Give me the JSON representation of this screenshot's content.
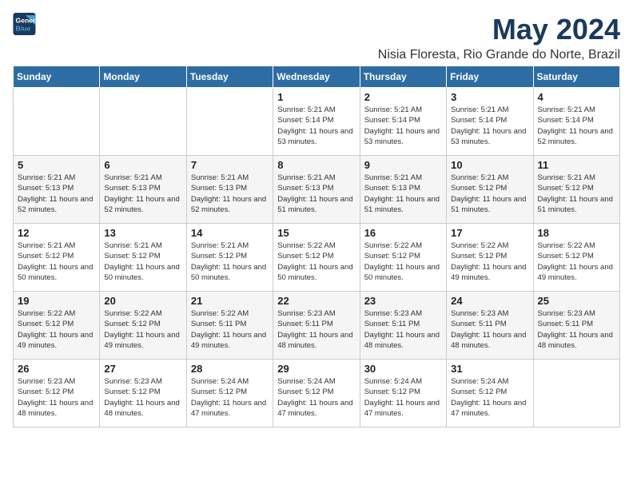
{
  "logo": {
    "line1": "General",
    "line2": "Blue"
  },
  "title": "May 2024",
  "location": "Nisia Floresta, Rio Grande do Norte, Brazil",
  "weekdays": [
    "Sunday",
    "Monday",
    "Tuesday",
    "Wednesday",
    "Thursday",
    "Friday",
    "Saturday"
  ],
  "weeks": [
    [
      {
        "day": "",
        "info": ""
      },
      {
        "day": "",
        "info": ""
      },
      {
        "day": "",
        "info": ""
      },
      {
        "day": "1",
        "info": "Sunrise: 5:21 AM\nSunset: 5:14 PM\nDaylight: 11 hours and 53 minutes."
      },
      {
        "day": "2",
        "info": "Sunrise: 5:21 AM\nSunset: 5:14 PM\nDaylight: 11 hours and 53 minutes."
      },
      {
        "day": "3",
        "info": "Sunrise: 5:21 AM\nSunset: 5:14 PM\nDaylight: 11 hours and 53 minutes."
      },
      {
        "day": "4",
        "info": "Sunrise: 5:21 AM\nSunset: 5:14 PM\nDaylight: 11 hours and 52 minutes."
      }
    ],
    [
      {
        "day": "5",
        "info": "Sunrise: 5:21 AM\nSunset: 5:13 PM\nDaylight: 11 hours and 52 minutes."
      },
      {
        "day": "6",
        "info": "Sunrise: 5:21 AM\nSunset: 5:13 PM\nDaylight: 11 hours and 52 minutes."
      },
      {
        "day": "7",
        "info": "Sunrise: 5:21 AM\nSunset: 5:13 PM\nDaylight: 11 hours and 52 minutes."
      },
      {
        "day": "8",
        "info": "Sunrise: 5:21 AM\nSunset: 5:13 PM\nDaylight: 11 hours and 51 minutes."
      },
      {
        "day": "9",
        "info": "Sunrise: 5:21 AM\nSunset: 5:13 PM\nDaylight: 11 hours and 51 minutes."
      },
      {
        "day": "10",
        "info": "Sunrise: 5:21 AM\nSunset: 5:12 PM\nDaylight: 11 hours and 51 minutes."
      },
      {
        "day": "11",
        "info": "Sunrise: 5:21 AM\nSunset: 5:12 PM\nDaylight: 11 hours and 51 minutes."
      }
    ],
    [
      {
        "day": "12",
        "info": "Sunrise: 5:21 AM\nSunset: 5:12 PM\nDaylight: 11 hours and 50 minutes."
      },
      {
        "day": "13",
        "info": "Sunrise: 5:21 AM\nSunset: 5:12 PM\nDaylight: 11 hours and 50 minutes."
      },
      {
        "day": "14",
        "info": "Sunrise: 5:21 AM\nSunset: 5:12 PM\nDaylight: 11 hours and 50 minutes."
      },
      {
        "day": "15",
        "info": "Sunrise: 5:22 AM\nSunset: 5:12 PM\nDaylight: 11 hours and 50 minutes."
      },
      {
        "day": "16",
        "info": "Sunrise: 5:22 AM\nSunset: 5:12 PM\nDaylight: 11 hours and 50 minutes."
      },
      {
        "day": "17",
        "info": "Sunrise: 5:22 AM\nSunset: 5:12 PM\nDaylight: 11 hours and 49 minutes."
      },
      {
        "day": "18",
        "info": "Sunrise: 5:22 AM\nSunset: 5:12 PM\nDaylight: 11 hours and 49 minutes."
      }
    ],
    [
      {
        "day": "19",
        "info": "Sunrise: 5:22 AM\nSunset: 5:12 PM\nDaylight: 11 hours and 49 minutes."
      },
      {
        "day": "20",
        "info": "Sunrise: 5:22 AM\nSunset: 5:12 PM\nDaylight: 11 hours and 49 minutes."
      },
      {
        "day": "21",
        "info": "Sunrise: 5:22 AM\nSunset: 5:11 PM\nDaylight: 11 hours and 49 minutes."
      },
      {
        "day": "22",
        "info": "Sunrise: 5:23 AM\nSunset: 5:11 PM\nDaylight: 11 hours and 48 minutes."
      },
      {
        "day": "23",
        "info": "Sunrise: 5:23 AM\nSunset: 5:11 PM\nDaylight: 11 hours and 48 minutes."
      },
      {
        "day": "24",
        "info": "Sunrise: 5:23 AM\nSunset: 5:11 PM\nDaylight: 11 hours and 48 minutes."
      },
      {
        "day": "25",
        "info": "Sunrise: 5:23 AM\nSunset: 5:11 PM\nDaylight: 11 hours and 48 minutes."
      }
    ],
    [
      {
        "day": "26",
        "info": "Sunrise: 5:23 AM\nSunset: 5:12 PM\nDaylight: 11 hours and 48 minutes."
      },
      {
        "day": "27",
        "info": "Sunrise: 5:23 AM\nSunset: 5:12 PM\nDaylight: 11 hours and 48 minutes."
      },
      {
        "day": "28",
        "info": "Sunrise: 5:24 AM\nSunset: 5:12 PM\nDaylight: 11 hours and 47 minutes."
      },
      {
        "day": "29",
        "info": "Sunrise: 5:24 AM\nSunset: 5:12 PM\nDaylight: 11 hours and 47 minutes."
      },
      {
        "day": "30",
        "info": "Sunrise: 5:24 AM\nSunset: 5:12 PM\nDaylight: 11 hours and 47 minutes."
      },
      {
        "day": "31",
        "info": "Sunrise: 5:24 AM\nSunset: 5:12 PM\nDaylight: 11 hours and 47 minutes."
      },
      {
        "day": "",
        "info": ""
      }
    ]
  ]
}
